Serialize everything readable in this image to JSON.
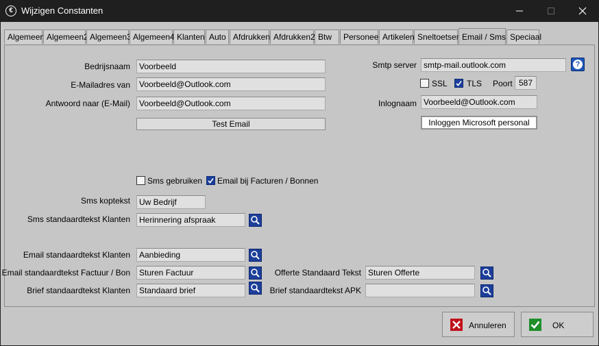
{
  "window": {
    "title": "Wijzigen Constanten",
    "app_icon": "€"
  },
  "tabs": [
    "Algemeen",
    "Algemeen2",
    "Algemeen3",
    "Algemeen4",
    "Klanten",
    "Auto",
    "Afdrukken",
    "Afdrukken2",
    "Btw",
    "Personeel",
    "Artikelen",
    "Sneltoetsen",
    "Email / Sms",
    "Speciaal"
  ],
  "active_tab": "Email / Sms",
  "email": {
    "bedrijfsnaam_label": "Bedrijsnaam",
    "bedrijfsnaam_value": "Voorbeeld",
    "emailadres_label": "E-Mailadres van",
    "emailadres_value": "Voorbeeld@Outlook.com",
    "antwoord_label": "Antwoord naar (E-Mail)",
    "antwoord_value": "Voorbeeld@Outlook.com",
    "test_button": "Test Email"
  },
  "smtp": {
    "server_label": "Smtp server",
    "server_value": "smtp-mail.outlook.com",
    "ssl_label": "SSL",
    "ssl_checked": false,
    "tls_label": "TLS",
    "tls_checked": true,
    "poort_label": "Poort",
    "poort_value": "587",
    "inlognaam_label": "Inlognaam",
    "inlognaam_value": "Voorbeeld@Outlook.com",
    "login_button": "Inloggen Microsoft personal"
  },
  "options": {
    "sms_gebruiken_label": "Sms gebruiken",
    "sms_gebruiken_checked": false,
    "email_facturen_label": "Email bij Facturen / Bonnen",
    "email_facturen_checked": true
  },
  "sms": {
    "koptekst_label": "Sms koptekst",
    "koptekst_value": "Uw Bedrijf",
    "standaardtekst_label": "Sms standaardtekst Klanten",
    "standaardtekst_value": "Herinnering afspraak"
  },
  "templates": {
    "email_klanten_label": "Email standaardtekst Klanten",
    "email_klanten_value": "Aanbieding",
    "email_factuur_label": "Email standaardtekst Factuur / Bon",
    "email_factuur_value": "Sturen Factuur",
    "brief_klanten_label": "Brief standaardtekst Klanten",
    "brief_klanten_value": "Standaard brief",
    "offerte_label": "Offerte Standaard Tekst",
    "offerte_value": "Sturen Offerte",
    "brief_apk_label": "Brief standaardtekst APK",
    "brief_apk_value": ""
  },
  "buttons": {
    "cancel": "Annuleren",
    "ok": "OK"
  },
  "colors": {
    "accent": "#1d3f9a",
    "cancel_red": "#c0121a",
    "ok_green": "#1f8f2a"
  }
}
